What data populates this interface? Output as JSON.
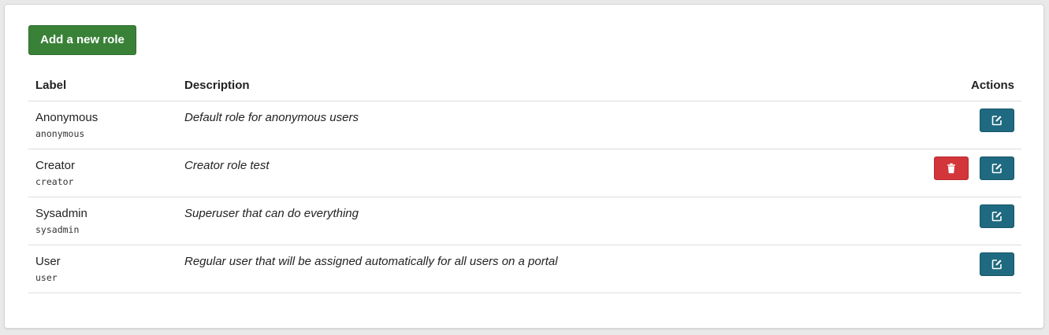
{
  "toolbar": {
    "add_role_label": "Add a new role"
  },
  "table": {
    "headers": {
      "label": "Label",
      "description": "Description",
      "actions": "Actions"
    },
    "rows": [
      {
        "label": "Anonymous",
        "code": "anonymous",
        "description": "Default role for anonymous users",
        "actions": [
          "edit"
        ]
      },
      {
        "label": "Creator",
        "code": "creator",
        "description": "Creator role test",
        "actions": [
          "delete",
          "edit"
        ]
      },
      {
        "label": "Sysadmin",
        "code": "sysadmin",
        "description": "Superuser that can do everything",
        "actions": [
          "edit"
        ]
      },
      {
        "label": "User",
        "code": "user",
        "description": "Regular user that will be assigned automatically for all users on a portal",
        "actions": [
          "edit"
        ]
      }
    ]
  },
  "icons": {
    "edit": "edit-icon",
    "delete": "trash-icon"
  },
  "colors": {
    "add_button": "#3a8138",
    "edit_button": "#1f6a80",
    "delete_button": "#d2363a"
  }
}
